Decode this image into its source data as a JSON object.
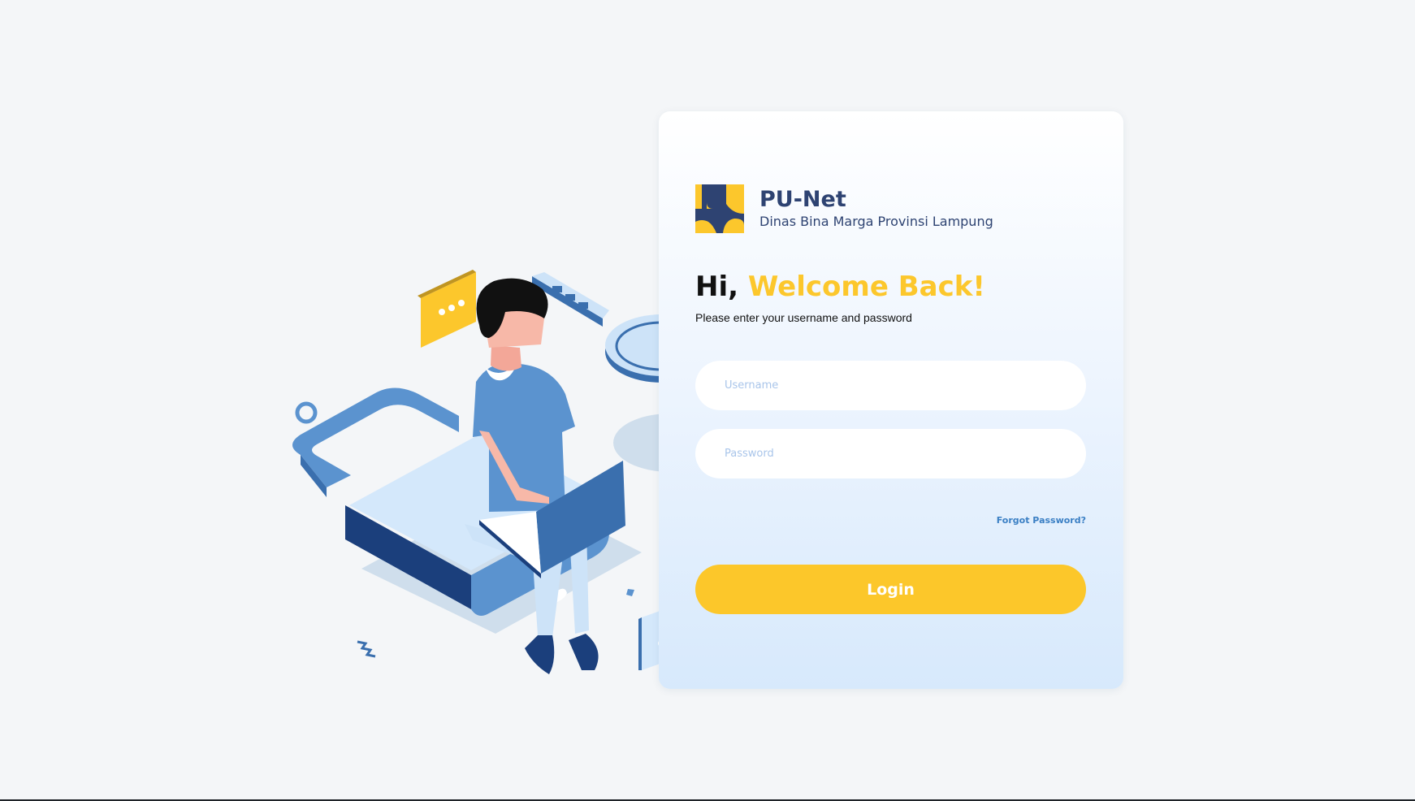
{
  "brand": {
    "name": "PU-Net",
    "subtitle": "Dinas Bina Marga Provinsi Lampung",
    "logo_colors": {
      "primary": "#2e4372",
      "accent": "#fcc72c"
    }
  },
  "login": {
    "greeting": "Hi,",
    "welcome": "Welcome Back!",
    "instruction": "Please enter your username and password",
    "username_placeholder": "Username",
    "password_placeholder": "Password",
    "forgot_password": "Forgot Password?",
    "submit_label": "Login"
  },
  "illustration": {
    "chat_icon_1": "chat-bubble-icon",
    "chat_icon_2": "chat-bubble-icon",
    "key_icon": "key-icon",
    "lock_icon": "padlock-icon",
    "laptop_icon": "laptop-icon"
  },
  "colors": {
    "background": "#f4f6f8",
    "accent_yellow": "#fcc72a",
    "brand_navy": "#2e4372",
    "link_blue": "#3a7fc4",
    "placeholder_blue": "#a9c5ea"
  }
}
